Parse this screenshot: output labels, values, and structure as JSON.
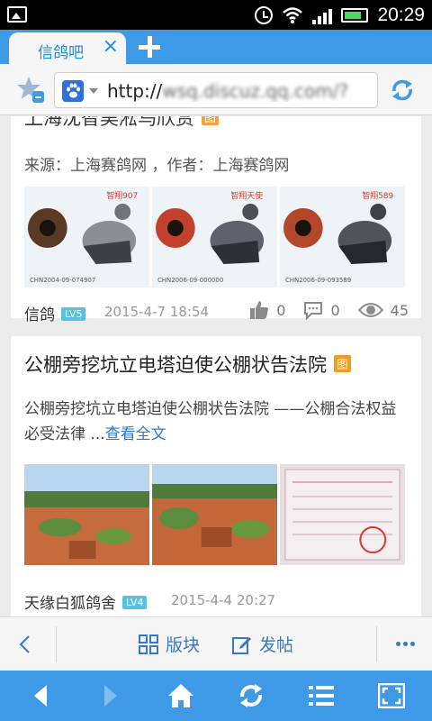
{
  "status_bar": {
    "time": "20:29"
  },
  "tab": {
    "title": "信鸽吧",
    "close": "×"
  },
  "address": {
    "url": "http://",
    "url_obscured": "wsq.discuz.qq.com/?"
  },
  "posts": [
    {
      "title": "上海沈智昊淞鸟欣赏",
      "badge": "图",
      "source_line": "来源：上海赛鸽网 ，作者：上海赛鸽网",
      "images": [
        {
          "label": "智翔907",
          "ring": "CHN2004-09-074907"
        },
        {
          "label": "智翔天使",
          "ring": "CHN2006-09-000000"
        },
        {
          "label": "智翔589",
          "ring": "CHN2006-09-093589"
        }
      ],
      "author": "信鸽",
      "level": "LV5",
      "date": "2015-4-7 18:54",
      "likes": "0",
      "comments": "0",
      "views": "45"
    },
    {
      "title": "公棚旁挖坑立电塔迫使公棚状告法院",
      "badge": "图",
      "summary": "公棚旁挖坑立电塔迫使公棚状告法院 ——公棚合法权益必受法律 ...",
      "read_more": "查看全文",
      "author": "天缘白狐鸽舍",
      "level": "LV4",
      "date": "2015-4-4 20:27"
    }
  ],
  "forum_bar": {
    "board": "版块",
    "post": "发帖"
  }
}
